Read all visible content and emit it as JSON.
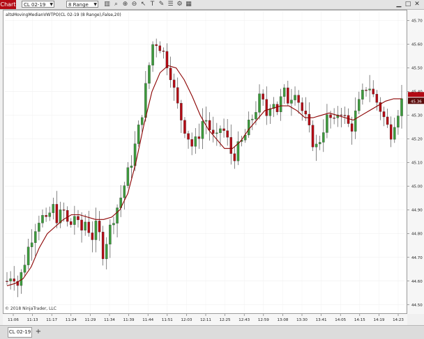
{
  "toolbar": {
    "tab_label": "Chart",
    "instrument": "CL 02-19",
    "period": "8 Range",
    "tool_icons": [
      "bars-icon",
      "magnify-icon",
      "zoom-in-icon",
      "zoom-out-icon",
      "pointer-icon",
      "text-icon",
      "pencil-icon",
      "properties-icon",
      "strategy-icon",
      "grid-icon"
    ],
    "window_icons": [
      "minimize-icon",
      "maximize-icon",
      "close-icon"
    ]
  },
  "indicator_label": "altsMovingMedianVWTPO(CL 02-19 (8 Range),False,20)",
  "copyright": "© 2018 NinjaTrader, LLC",
  "bottom_tab": "CL 02-19",
  "add_tab_glyph": "+",
  "colors": {
    "up": "#3c9a3c",
    "down": "#b30a14",
    "line": "#8b0000",
    "price_tag": "#5a0a0a"
  },
  "chart_data": {
    "type": "candlestick",
    "title": "",
    "xlabel": "",
    "ylabel": "",
    "ylim": [
      44.47,
      45.74
    ],
    "yticks": [
      44.5,
      44.6,
      44.7,
      44.8,
      44.9,
      45.0,
      45.1,
      45.2,
      45.3,
      45.4,
      45.5,
      45.6,
      45.7
    ],
    "ytick_labels": [
      "44.50",
      "44.60",
      "44.70",
      "44.80",
      "44.90",
      "45.00",
      "45.10",
      "45.20",
      "45.30",
      "45.40",
      "45.50",
      "45.60",
      "45.70"
    ],
    "last_price": "45.36",
    "xtick_labels": [
      "11:06",
      "11:13",
      "11:17",
      "11:24",
      "11:29",
      "11:34",
      "11:39",
      "11:44",
      "11:51",
      "12:03",
      "12:11",
      "12:25",
      "12:43",
      "12:59",
      "13:08",
      "13:30",
      "13:41",
      "14:05",
      "14:15",
      "14:19",
      "14:23"
    ],
    "close_path": [
      44.6,
      44.64,
      44.58,
      44.67,
      44.76,
      44.83,
      44.88,
      44.84,
      44.92,
      44.86,
      44.9,
      44.82,
      44.88,
      44.8,
      44.86,
      44.78,
      44.84,
      44.72,
      44.8,
      44.88,
      44.94,
      45.02,
      45.1,
      45.2,
      45.32,
      45.48,
      45.62,
      45.6,
      45.55,
      45.48,
      45.36,
      45.28,
      45.22,
      45.16,
      45.22,
      45.3,
      45.24,
      45.18,
      45.26,
      45.2,
      45.12,
      45.16,
      45.2,
      45.26,
      45.32,
      45.38,
      45.3,
      45.38,
      45.32,
      45.4,
      45.36,
      45.42,
      45.34,
      45.28,
      45.2,
      45.16,
      45.24,
      45.3,
      45.26,
      45.34,
      45.28,
      45.24,
      45.32,
      45.38,
      45.44,
      45.38,
      45.34,
      45.28,
      45.22,
      45.3,
      45.36
    ],
    "ma_path": [
      44.58,
      44.59,
      44.61,
      44.66,
      44.74,
      44.8,
      44.83,
      44.86,
      44.88,
      44.88,
      44.87,
      44.86,
      44.86,
      44.87,
      44.9,
      44.97,
      45.1,
      45.26,
      45.4,
      45.48,
      45.51,
      45.5,
      45.45,
      45.38,
      45.3,
      45.24,
      45.2,
      45.16,
      45.16,
      45.19,
      45.24,
      45.28,
      45.32,
      45.33,
      45.34,
      45.34,
      45.32,
      45.29,
      45.29,
      45.3,
      45.31,
      45.3,
      45.29,
      45.28,
      45.3,
      45.32,
      45.34,
      45.36,
      45.37,
      45.37
    ]
  }
}
